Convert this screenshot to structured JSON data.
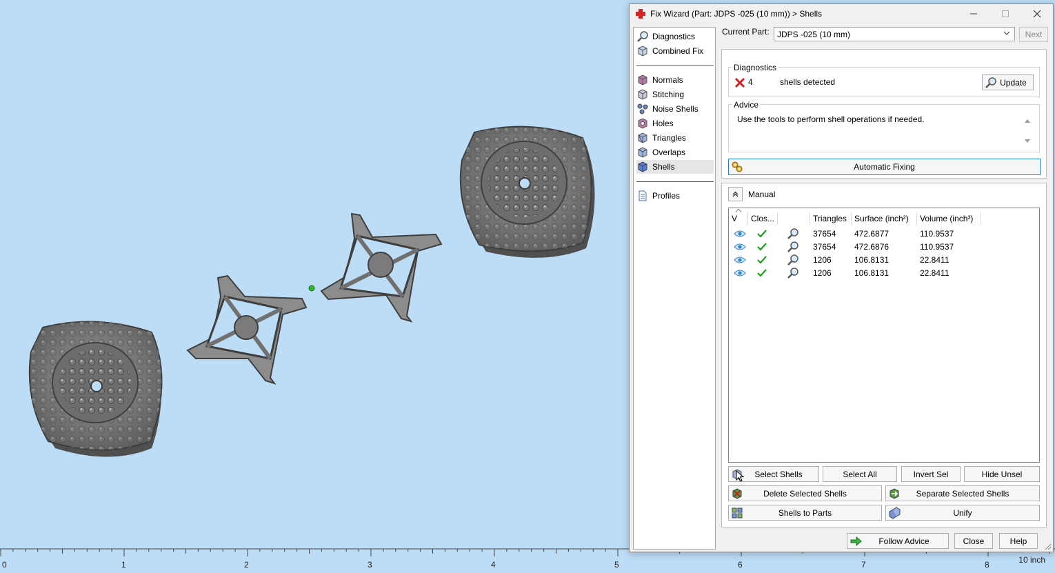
{
  "ruler": {
    "ticks": [
      "0",
      "1",
      "2",
      "3",
      "4",
      "5",
      "6",
      "7",
      "8"
    ],
    "unit": "10 inch"
  },
  "dialog": {
    "title": "Fix Wizard (Part: JDPS -025 (10 mm)) > Shells",
    "window_controls": {
      "minimize_icon": "minimize-icon",
      "maximize_icon": "maximize-icon",
      "close_icon": "close-icon"
    }
  },
  "nav": {
    "top": [
      {
        "label": "Diagnostics",
        "icon": "magnifier-icon"
      },
      {
        "label": "Combined Fix",
        "icon": "cube-icon"
      }
    ],
    "fixes": [
      {
        "label": "Normals",
        "icon": "normals-icon"
      },
      {
        "label": "Stitching",
        "icon": "stitching-icon"
      },
      {
        "label": "Noise Shells",
        "icon": "noise-shells-icon"
      },
      {
        "label": "Holes",
        "icon": "holes-icon"
      },
      {
        "label": "Triangles",
        "icon": "triangles-icon"
      },
      {
        "label": "Overlaps",
        "icon": "overlaps-icon"
      },
      {
        "label": "Shells",
        "icon": "shells-icon",
        "selected": true
      }
    ],
    "bottom": [
      {
        "label": "Profiles",
        "icon": "document-icon"
      }
    ]
  },
  "current_part": {
    "label": "Current Part:",
    "value": "JDPS -025 (10 mm)",
    "next_label": "Next"
  },
  "diagnostics": {
    "title": "Diagnostics",
    "count": "4",
    "message": "shells detected",
    "update_label": "Update"
  },
  "advice": {
    "title": "Advice",
    "text": "Use the tools to perform shell operations if needed."
  },
  "automatic_fixing_label": "Automatic Fixing",
  "manual": {
    "title": "Manual",
    "columns": [
      "V",
      "Clos...",
      "",
      "Triangles",
      "Surface (inch²)",
      "Volume (inch³)"
    ],
    "rows": [
      {
        "triangles": "37654",
        "surface": "472.6877",
        "volume": "110.9537"
      },
      {
        "triangles": "37654",
        "surface": "472.6876",
        "volume": "110.9537"
      },
      {
        "triangles": "1206",
        "surface": "106.8131",
        "volume": "22.8411"
      },
      {
        "triangles": "1206",
        "surface": "106.8131",
        "volume": "22.8411"
      }
    ],
    "buttons": {
      "select_shells": "Select Shells",
      "select_all": "Select All",
      "invert_sel": "Invert Sel",
      "hide_unsel": "Hide Unsel",
      "delete_selected": "Delete Selected Shells",
      "separate_selected": "Separate Selected Shells",
      "shells_to_parts": "Shells to Parts",
      "unify": "Unify"
    }
  },
  "footer": {
    "follow_advice": "Follow Advice",
    "close": "Close",
    "help": "Help"
  },
  "colors": {
    "viewport_bg": "#bddcf6",
    "dialog_bg": "#f0f0f0",
    "model_gray": "#8a8a8a",
    "check_green": "#1aa31a",
    "error_red": "#d02020",
    "accent_blue": "#2d7fd3"
  }
}
